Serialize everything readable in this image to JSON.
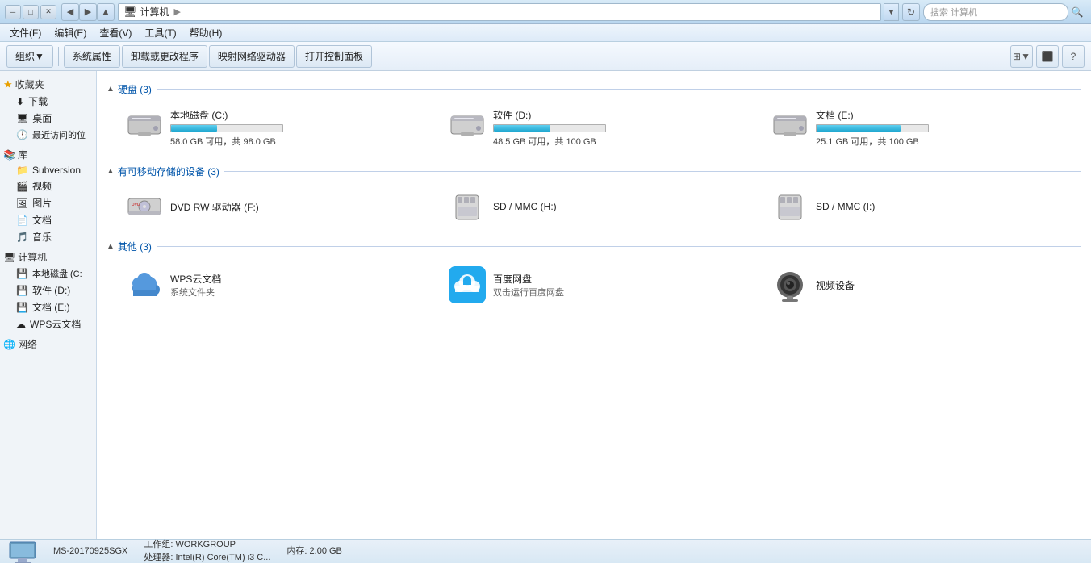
{
  "titleBar": {
    "path": "计算机",
    "searchPlaceholder": "搜索 计算机"
  },
  "menuBar": {
    "items": [
      {
        "label": "文件(F)"
      },
      {
        "label": "编辑(E)"
      },
      {
        "label": "查看(V)"
      },
      {
        "label": "工具(T)"
      },
      {
        "label": "帮助(H)"
      }
    ]
  },
  "toolbar": {
    "organize": "组织▼",
    "sysProps": "系统属性",
    "uninstall": "卸载或更改程序",
    "mapDrive": "映射网络驱动器",
    "openCtrlPanel": "打开控制面板"
  },
  "sidebar": {
    "favorites": {
      "header": "收藏夹",
      "items": [
        {
          "label": "下载",
          "icon": "⬇"
        },
        {
          "label": "桌面",
          "icon": "🖥"
        },
        {
          "label": "最近访问的位",
          "icon": "🕐"
        }
      ]
    },
    "library": {
      "header": "库",
      "items": [
        {
          "label": "Subversion",
          "icon": "📁"
        },
        {
          "label": "视频",
          "icon": "🎬"
        },
        {
          "label": "图片",
          "icon": "🖼"
        },
        {
          "label": "文档",
          "icon": "📄"
        },
        {
          "label": "音乐",
          "icon": "🎵"
        }
      ]
    },
    "computer": {
      "header": "计算机",
      "items": [
        {
          "label": "本地磁盘 (C:",
          "icon": "💾"
        },
        {
          "label": "软件 (D:)",
          "icon": "💾"
        },
        {
          "label": "文档 (E:)",
          "icon": "💾"
        },
        {
          "label": "WPS云文档",
          "icon": "☁"
        }
      ]
    },
    "network": {
      "header": "网络"
    }
  },
  "content": {
    "hardDisks": {
      "sectionTitle": "硬盘 (3)",
      "drives": [
        {
          "name": "本地磁盘 (C:)",
          "freeText": "58.0 GB 可用，共 98.0 GB",
          "freePercent": 59,
          "usedPercent": 41
        },
        {
          "name": "软件 (D:)",
          "freeText": "48.5 GB 可用，共 100 GB",
          "freePercent": 49,
          "usedPercent": 51
        },
        {
          "name": "文档 (E:)",
          "freeText": "25.1 GB 可用，共 100 GB",
          "freePercent": 25,
          "usedPercent": 75
        }
      ]
    },
    "removable": {
      "sectionTitle": "有可移动存储的设备 (3)",
      "devices": [
        {
          "name": "DVD RW 驱动器 (F:)"
        },
        {
          "name": "SD / MMC (H:)"
        },
        {
          "name": "SD / MMC (I:)"
        }
      ]
    },
    "other": {
      "sectionTitle": "其他 (3)",
      "items": [
        {
          "name": "WPS云文档",
          "sub": "系统文件夹"
        },
        {
          "name": "百度网盘",
          "sub": "双击运行百度网盘"
        },
        {
          "name": "视频设备",
          "sub": ""
        }
      ]
    }
  },
  "statusBar": {
    "computerName": "MS-20170925SGX",
    "workgroup": "工作组: WORKGROUP",
    "memory": "内存: 2.00 GB",
    "processor": "处理器: Intel(R) Core(TM) i3 C..."
  }
}
